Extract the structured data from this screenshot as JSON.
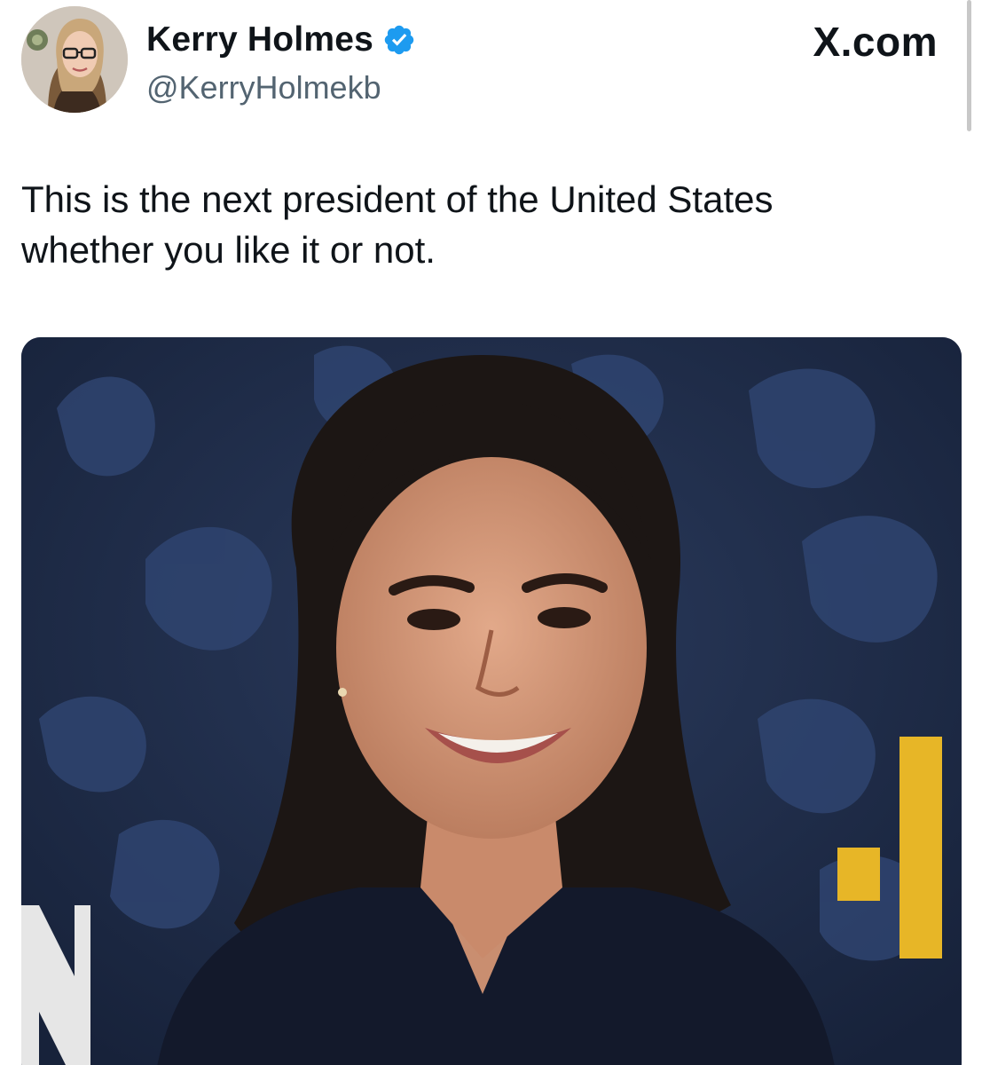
{
  "tweet": {
    "author": {
      "display_name": "Kerry Holmes",
      "handle": "@KerryHolmekb",
      "verified": true,
      "verified_icon": "verified-badge-icon",
      "avatar_icon": "profile-photo"
    },
    "site": "X.com",
    "text": "This is the next president of the United States whether you like it or not.",
    "media": {
      "kind": "photo",
      "description_icon": "portrait-photo"
    }
  },
  "colors": {
    "text_primary": "#0f1419",
    "text_secondary": "#536471",
    "verified_blue": "#1d9bf0",
    "media_background": "#1d2a44"
  }
}
